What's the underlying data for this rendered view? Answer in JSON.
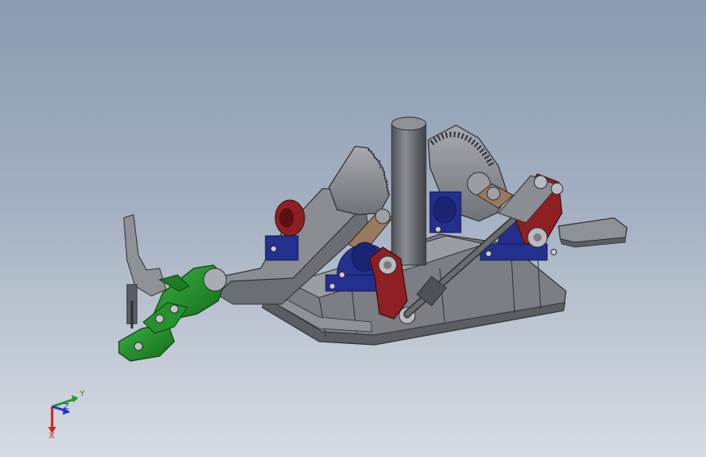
{
  "viewport": {
    "background_top": "#8b9bb1",
    "background_bottom": "#d6dce4"
  },
  "colors": {
    "steel": "#8a8d92",
    "steel_dark": "#5b5e63",
    "steel_light": "#b4b7bc",
    "bearing_blue": "#23308f",
    "link_red": "#8e1f22",
    "bronze": "#9a7a5e",
    "foot_green": "#1e8c24",
    "rod": "#6a6c70"
  },
  "triad": {
    "x_label": "X",
    "y_label": "Y",
    "z_label": "Z",
    "x_color": "#cc2222",
    "y_color": "#1f9a2c",
    "z_color": "#2036c8"
  }
}
